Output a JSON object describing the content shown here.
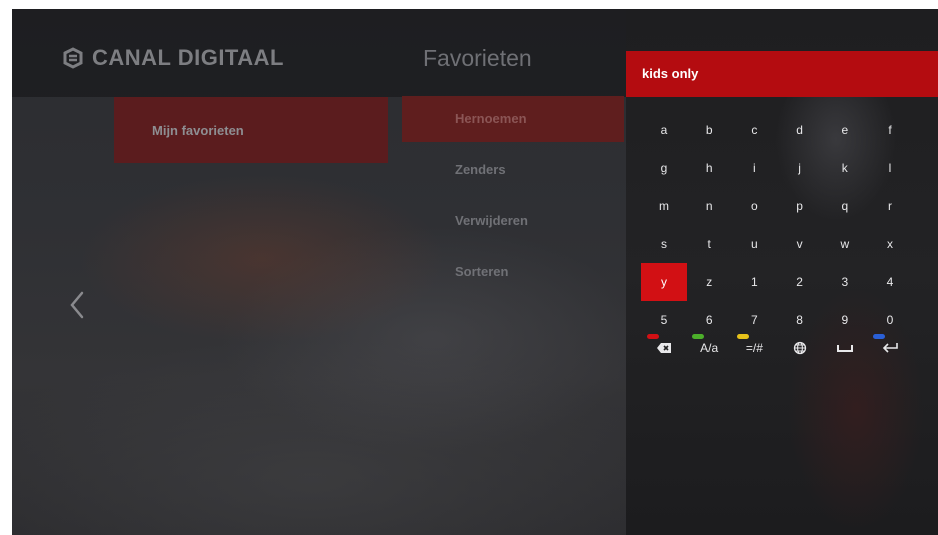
{
  "header": {
    "brand": "CANAL DIGITAAL",
    "title": "Favorieten"
  },
  "favorites": {
    "list_label": "Mijn favorieten"
  },
  "menu": {
    "items": [
      {
        "label": "Hernoemen",
        "active": true
      },
      {
        "label": "Zenders",
        "active": false
      },
      {
        "label": "Verwijderen",
        "active": false
      },
      {
        "label": "Sorteren",
        "active": false
      }
    ]
  },
  "keyboard": {
    "input_value": "kids only",
    "selected_key": "y",
    "rows": [
      [
        "a",
        "b",
        "c",
        "d",
        "e",
        "f"
      ],
      [
        "g",
        "h",
        "i",
        "j",
        "k",
        "l"
      ],
      [
        "m",
        "n",
        "o",
        "p",
        "q",
        "r"
      ],
      [
        "s",
        "t",
        "u",
        "v",
        "w",
        "x"
      ],
      [
        "y",
        "z",
        "1",
        "2",
        "3",
        "4"
      ],
      [
        "5",
        "6",
        "7",
        "8",
        "9",
        "0"
      ]
    ],
    "function_keys": [
      {
        "name": "backspace-icon",
        "label": "",
        "dot_color": "#d21014"
      },
      {
        "name": "case-toggle",
        "label": "A/a",
        "dot_color": "#4caf2a"
      },
      {
        "name": "symbols-toggle",
        "label": "=/#",
        "dot_color": "#e6c21a"
      },
      {
        "name": "globe-icon",
        "label": "",
        "dot_color": ""
      },
      {
        "name": "space-icon",
        "label": "",
        "dot_color": ""
      },
      {
        "name": "enter-icon",
        "label": "",
        "dot_color": "#2a5fd6"
      }
    ]
  },
  "colors": {
    "accent": "#d21014",
    "input_bar": "#b40c10"
  }
}
